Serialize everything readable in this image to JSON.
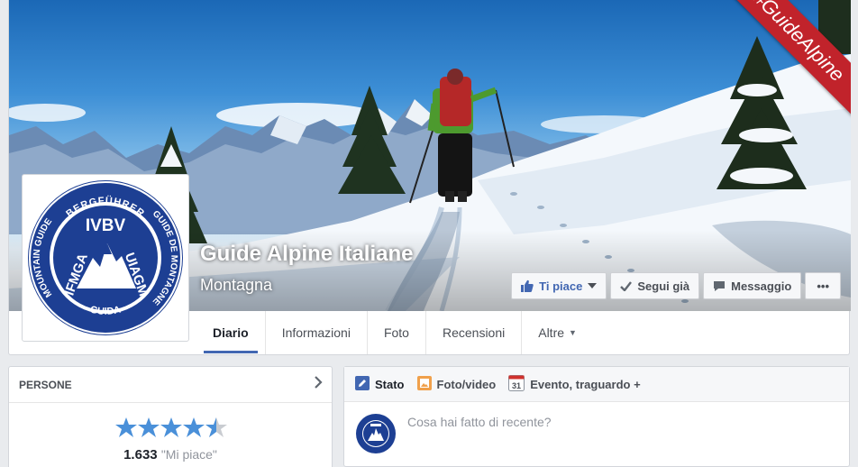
{
  "page": {
    "name": "Guide Alpine Italiane",
    "category": "Montagna",
    "hashtag": "#GuideAlpine"
  },
  "actions": {
    "like": "Ti piace",
    "follow": "Segui già",
    "message": "Messaggio",
    "more": "•••"
  },
  "tabs": [
    {
      "label": "Diario"
    },
    {
      "label": "Informazioni"
    },
    {
      "label": "Foto"
    },
    {
      "label": "Recensioni"
    },
    {
      "label": "Altre"
    }
  ],
  "people": {
    "title": "PERSONE",
    "rating": 4.5,
    "likes_count": "1.633",
    "likes_label": "\"Mi piace\""
  },
  "composer": {
    "tabs": [
      {
        "label": "Stato"
      },
      {
        "label": "Foto/video"
      },
      {
        "label": "Evento, traguardo +"
      }
    ],
    "calendar_day": "31",
    "placeholder": "Cosa hai fatto di recente?"
  },
  "logo": {
    "ring_top": "BERGFÜHRER",
    "ring_left": "MOUNTAIN GUIDE",
    "ring_right": "GUIDE DE MONTAGNE",
    "ring_bottom": "GUIDA",
    "line1": "IVBV",
    "line2": "IFMGA",
    "line3": "UIAGM"
  },
  "colors": {
    "brand_blue": "#4267b2",
    "logo_blue": "#1d3f93",
    "ribbon_red": "#c1232b",
    "star_blue": "#4a90d9"
  }
}
